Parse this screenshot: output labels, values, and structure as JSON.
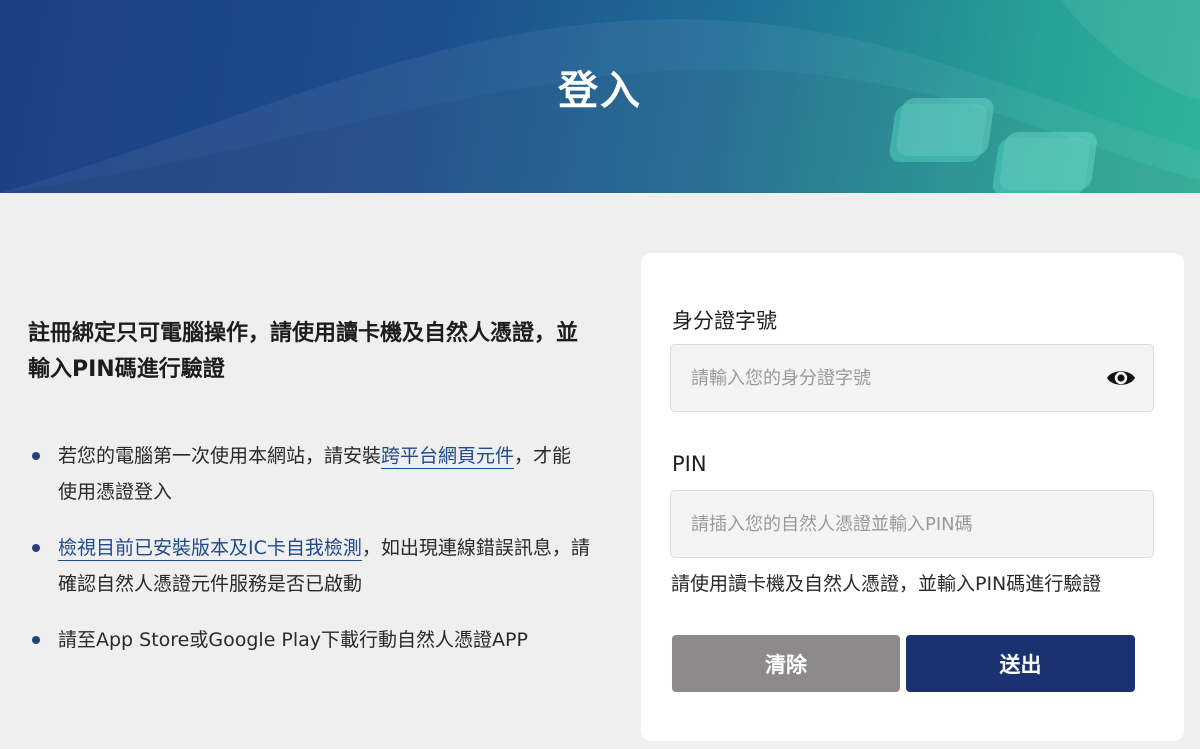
{
  "header": {
    "title": "登入"
  },
  "intro": {
    "text": "註冊綁定只可電腦操作，請使用讀卡機及自然人憑證，並輸入PIN碼進行驗證"
  },
  "tips": [
    {
      "before": "若您的電腦第一次使用本網站，請安裝",
      "link": "跨平台網頁元件",
      "after": "，才能使用憑證登入"
    },
    {
      "before": "",
      "link": "檢視目前已安裝版本及IC卡自我檢測",
      "after": "，如出現連線錯誤訊息，請確認自然人憑證元件服務是否已啟動"
    },
    {
      "before": "請至App Store或Google Play下載行動自然人憑證APP",
      "link": "",
      "after": ""
    }
  ],
  "form": {
    "id_label": "身分證字號",
    "id_placeholder": "請輸入您的身分證字號",
    "id_value": "",
    "eye_icon": "eye-icon",
    "pin_label": "PIN",
    "pin_placeholder": "請插入您的自然人憑證並輸入PIN碼",
    "pin_value": "",
    "hint": "請使用讀卡機及自然人憑證，並輸入PIN碼進行驗證",
    "clear_label": "清除",
    "submit_label": "送出"
  },
  "colors": {
    "primary": "#1a3370",
    "link": "#1f4a8c",
    "clear_button": "#8c8a8a",
    "background": "#efefef"
  }
}
